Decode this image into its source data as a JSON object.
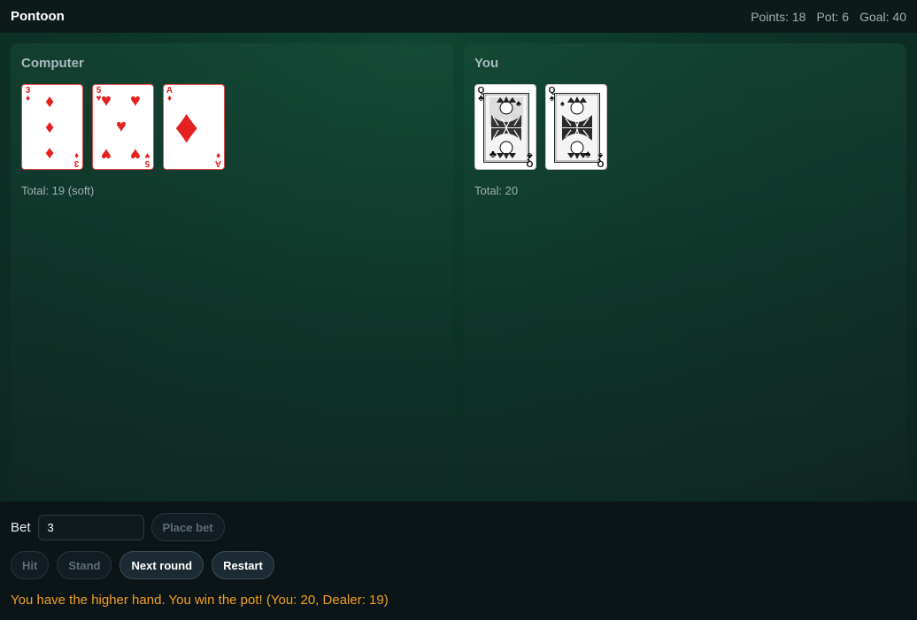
{
  "header": {
    "title": "Pontoon",
    "points": "Points: 18",
    "pot": "Pot: 6",
    "goal": "Goal: 40"
  },
  "dealer": {
    "title": "Computer",
    "cards": [
      {
        "rank": "3",
        "suit": "♦",
        "color": "red"
      },
      {
        "rank": "5",
        "suit": "♥",
        "color": "red"
      },
      {
        "rank": "A",
        "suit": "♦",
        "color": "red"
      }
    ],
    "total": "Total: 19 (soft)"
  },
  "player": {
    "title": "You",
    "cards": [
      {
        "rank": "Q",
        "suit": "♣",
        "color": "black"
      },
      {
        "rank": "Q",
        "suit": "♠",
        "color": "black"
      }
    ],
    "total": "Total: 20"
  },
  "controls": {
    "bet_label": "Bet",
    "bet_value": "3",
    "place_bet_label": "Place bet",
    "hit_label": "Hit",
    "stand_label": "Stand",
    "next_round_label": "Next round",
    "restart_label": "Restart"
  },
  "message": "You have the higher hand. You win the pot! (You: 20, Dealer: 19)",
  "colors": {
    "message": "#f0a020",
    "card_red": "#e52020",
    "table": "#0f4632"
  }
}
